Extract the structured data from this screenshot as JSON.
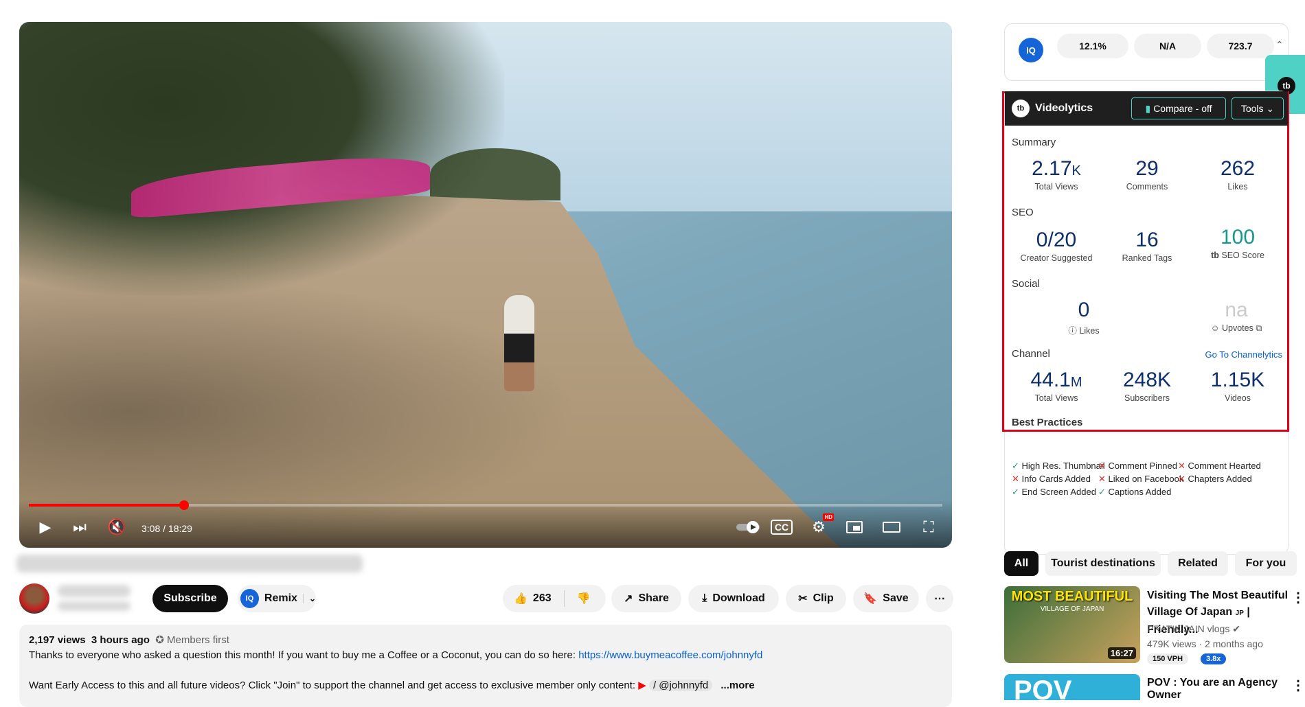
{
  "player": {
    "time": "3:08 / 18:29",
    "progress_fraction": 0.17,
    "hd_badge": "HD"
  },
  "channel": {
    "subscribe_label": "Subscribe",
    "remix_label": "Remix"
  },
  "actions": {
    "like_count": "263",
    "share": "Share",
    "download": "Download",
    "clip": "Clip",
    "save": "Save"
  },
  "description": {
    "views": "2,197 views",
    "ago": "3 hours ago",
    "members": "Members first",
    "line1": "Thanks to everyone who asked a question this month! If you want to buy me a Coffee or a Coconut, you can do so here: ",
    "link": "https://www.buymeacoffee.com/johnnyfd",
    "line2": "Want Early Access to this and all future videos? Click \"Join\" to support the channel and get access to exclusive member only content: ",
    "handle": "/ @johnnyfd",
    "more": "...more"
  },
  "topbar": {
    "pill1": "12.1%",
    "pill2": "N/A",
    "pill3": "723.7"
  },
  "videolytics": {
    "title": "Videolytics",
    "compare": "Compare - off",
    "tools": "Tools",
    "summary_label": "Summary",
    "total_views": "2.17",
    "total_views_unit": "K",
    "total_views_label": "Total Views",
    "comments": "29",
    "comments_label": "Comments",
    "likes": "262",
    "likes_label": "Likes",
    "seo_label": "SEO",
    "creator_suggested": "0/20",
    "creator_suggested_label": "Creator Suggested",
    "ranked_tags": "16",
    "ranked_tags_label": "Ranked Tags",
    "seo_score": "100",
    "seo_score_label": "SEO Score",
    "social_label": "Social",
    "social_likes": "0",
    "social_likes_label": "Likes",
    "upvotes": "na",
    "upvotes_label": "Upvotes",
    "channel_label": "Channel",
    "channel_link": "Go To Channelytics",
    "ch_views": "44.1",
    "ch_views_unit": "M",
    "ch_views_label": "Total Views",
    "ch_subs": "248K",
    "ch_subs_label": "Subscribers",
    "ch_videos": "1.15K",
    "ch_videos_label": "Videos",
    "best_practices_label": "Best Practices",
    "bp": [
      {
        "text": "High Res. Thumbnail",
        "ok": true
      },
      {
        "text": "Comment Pinned",
        "ok": false
      },
      {
        "text": "Comment Hearted",
        "ok": false
      },
      {
        "text": "Info Cards Added",
        "ok": false
      },
      {
        "text": "Liked on Facebook",
        "ok": false
      },
      {
        "text": "Chapters Added",
        "ok": false
      },
      {
        "text": "End Screen Added",
        "ok": true
      },
      {
        "text": "Captions Added",
        "ok": true
      }
    ]
  },
  "chips": [
    "All",
    "Tourist destinations",
    "Related",
    "For you"
  ],
  "recs": [
    {
      "thumb_text": "MOST BEAUTIFUL",
      "thumb_sub": "VILLAGE OF JAPAN",
      "duration": "16:27",
      "title": "Visiting The Most Beautiful Village Of Japan",
      "title_suffix": "JP",
      "title_end": "| Friendly...",
      "channel": "PRATIK JAIN vlogs",
      "meta": "479K views · 2 months ago",
      "badge1": "150 VPH",
      "badge2": "3.8x"
    },
    {
      "thumb_text": "POV",
      "title": "POV : You are an Agency Owner"
    }
  ],
  "colors": {
    "accent_red": "#ff0000",
    "videolytics_border": "#e3001b",
    "teal": "#4fd1c5",
    "link_blue": "#065fd4"
  }
}
